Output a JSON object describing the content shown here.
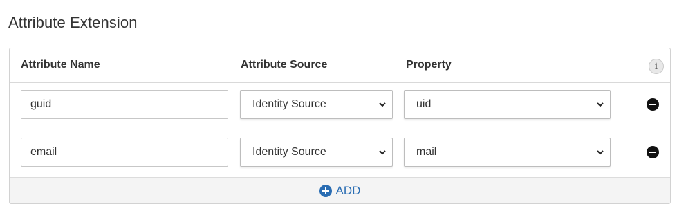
{
  "section": {
    "title": "Attribute Extension"
  },
  "table": {
    "headers": {
      "attribute_name": "Attribute Name",
      "attribute_source": "Attribute Source",
      "property": "Property",
      "info": "i"
    },
    "rows": [
      {
        "attribute_name": "guid",
        "attribute_source": "Identity Source",
        "property": "uid"
      },
      {
        "attribute_name": "email",
        "attribute_source": "Identity Source",
        "property": "mail"
      }
    ]
  },
  "footer": {
    "add_label": "ADD"
  },
  "icons": {
    "info": "info-icon",
    "remove": "minus-circle-icon",
    "add": "plus-circle-icon",
    "dropdown": "chevron-down-icon"
  },
  "colors": {
    "accent": "#2a6db3",
    "remove": "#111111"
  }
}
